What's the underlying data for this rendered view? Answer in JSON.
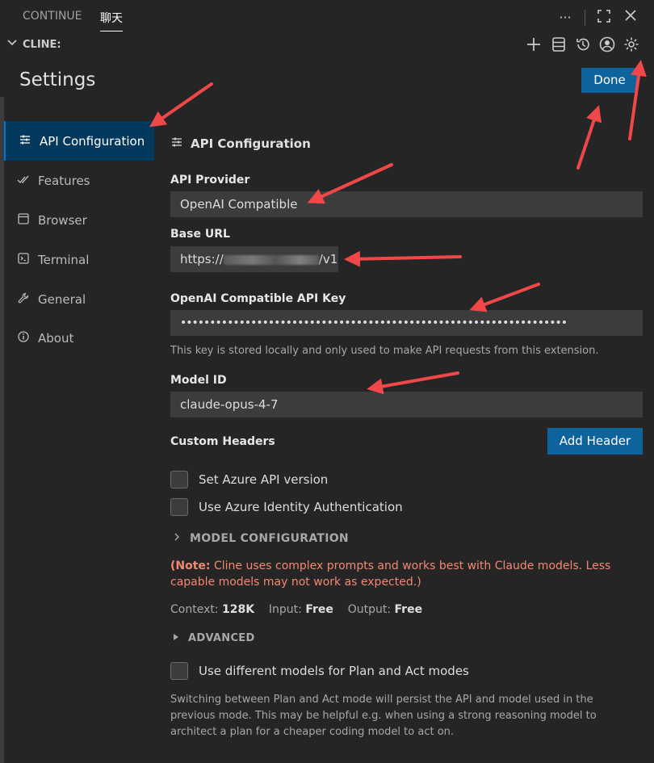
{
  "tabs": [
    {
      "label": "CONTINUE"
    },
    {
      "label": "聊天"
    }
  ],
  "panel": {
    "title": "CLINE:"
  },
  "settings": {
    "title": "Settings",
    "done_label": "Done"
  },
  "sidebar": {
    "items": [
      {
        "label": "API Configuration",
        "icon": "sliders-icon"
      },
      {
        "label": "Features",
        "icon": "check-double-icon"
      },
      {
        "label": "Browser",
        "icon": "browser-icon"
      },
      {
        "label": "Terminal",
        "icon": "terminal-icon"
      },
      {
        "label": "General",
        "icon": "wrench-icon"
      },
      {
        "label": "About",
        "icon": "info-icon"
      }
    ]
  },
  "main": {
    "section_title": "API Configuration",
    "api_provider_label": "API Provider",
    "api_provider_value": "OpenAI Compatible",
    "base_url_label": "Base URL",
    "base_url_prefix": "https://",
    "base_url_suffix": "/v1",
    "api_key_label": "OpenAI Compatible API Key",
    "api_key_value": "••••••••••••••••••••••••••••••••••••••••••••••••••••••••••••••••••",
    "api_key_hint": "This key is stored locally and only used to make API requests from this extension.",
    "model_id_label": "Model ID",
    "model_id_value": "claude-opus-4-7",
    "custom_headers_label": "Custom Headers",
    "add_header_label": "Add Header",
    "azure_version_label": "Set Azure API version",
    "azure_identity_label": "Use Azure Identity Authentication",
    "model_config_label": "MODEL CONFIGURATION",
    "note_prefix": "(Note:",
    "note_text": " Cline uses complex prompts and works best with Claude models. Less capable models may not work as expected.)",
    "context_label": "Context:",
    "context_value": "128K",
    "input_label": "Input:",
    "input_value": "Free",
    "output_label": "Output:",
    "output_value": "Free",
    "advanced_label": "ADVANCED",
    "plan_act_label": "Use different models for Plan and Act modes",
    "plan_act_hint": "Switching between Plan and Act mode will persist the API and model used in the previous mode. This may be helpful e.g. when using a strong reasoning model to architect a plan for a cheaper coding model to act on."
  },
  "colors": {
    "accent": "#0e639c",
    "annotation": "#f04848",
    "note": "#f48771"
  }
}
